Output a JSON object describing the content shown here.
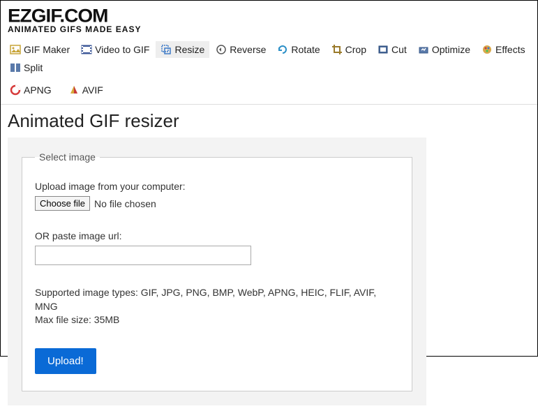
{
  "logo": {
    "main": "EZGIF.COM",
    "sub": "ANIMATED GIFS MADE EASY"
  },
  "nav": {
    "items": [
      {
        "label": "GIF Maker"
      },
      {
        "label": "Video to GIF"
      },
      {
        "label": "Resize"
      },
      {
        "label": "Reverse"
      },
      {
        "label": "Rotate"
      },
      {
        "label": "Crop"
      },
      {
        "label": "Cut"
      },
      {
        "label": "Optimize"
      },
      {
        "label": "Effects"
      },
      {
        "label": "Split"
      }
    ],
    "row2": [
      {
        "label": "APNG"
      },
      {
        "label": "AVIF"
      }
    ],
    "active_index": 2
  },
  "page": {
    "title": "Animated GIF resizer",
    "select_image": {
      "legend": "Select image",
      "upload_label": "Upload image from your computer:",
      "choose_file_label": "Choose file",
      "no_file_text": "No file chosen",
      "or_paste_label": "OR paste image url:",
      "url_value": "",
      "supported_line1": "Supported image types: GIF, JPG, PNG, BMP, WebP, APNG, HEIC, FLIF, AVIF, MNG",
      "supported_line2": "Max file size: 35MB",
      "upload_button": "Upload!"
    }
  }
}
